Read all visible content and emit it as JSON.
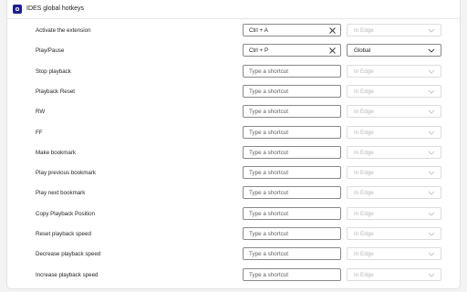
{
  "header": {
    "title": "IDES global hotkeys"
  },
  "colors": {
    "accent": "#1e1e96",
    "disabled_text": "#b9b9b9",
    "border": "#8a8a8a"
  },
  "rows": [
    {
      "label": "Activate the extension",
      "shortcut": "Ctrl + A",
      "has_clear": true,
      "scope": "In Edge",
      "scope_enabled": false
    },
    {
      "label": "Play/Pause",
      "shortcut": "Ctrl + P",
      "has_clear": true,
      "scope": "Global",
      "scope_enabled": true
    },
    {
      "label": "Stop playback",
      "placeholder": "Type a shortcut",
      "scope": "In Edge",
      "scope_enabled": false
    },
    {
      "label": "Playback Reset",
      "placeholder": "Type a shortcut",
      "scope": "In Edge",
      "scope_enabled": false
    },
    {
      "label": "RW",
      "placeholder": "Type a shortcut",
      "scope": "In Edge",
      "scope_enabled": false
    },
    {
      "label": "FF",
      "placeholder": "Type a shortcut",
      "scope": "In Edge",
      "scope_enabled": false
    },
    {
      "label": "Make bookmark",
      "placeholder": "Type a shortcut",
      "scope": "In Edge",
      "scope_enabled": false
    },
    {
      "label": "Play previous bookmark",
      "placeholder": "Type a shortcut",
      "scope": "In Edge",
      "scope_enabled": false
    },
    {
      "label": "Play next bookmark",
      "placeholder": "Type a shortcut",
      "scope": "In Edge",
      "scope_enabled": false
    },
    {
      "label": "Copy Playback Position",
      "placeholder": "Type a shortcut",
      "scope": "In Edge",
      "scope_enabled": false
    },
    {
      "label": "Reset playback speed",
      "placeholder": "Type a shortcut",
      "scope": "In Edge",
      "scope_enabled": false
    },
    {
      "label": "Decrease playback speed",
      "placeholder": "Type a shortcut",
      "scope": "In Edge",
      "scope_enabled": false
    },
    {
      "label": "Increase playback speed",
      "placeholder": "Type a shortcut",
      "scope": "In Edge",
      "scope_enabled": false
    }
  ]
}
